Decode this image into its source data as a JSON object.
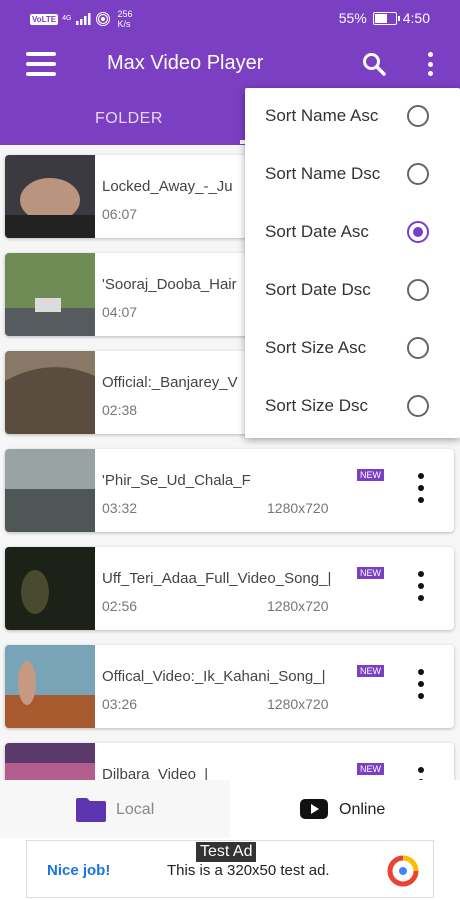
{
  "status_bar": {
    "network_tag": "VoLTE",
    "signal_type": "4G",
    "data_speed": "256\nK/s",
    "battery": "55%",
    "battery_level": 0.55,
    "time": "4:50"
  },
  "app_bar": {
    "title": "Max Video Player",
    "tab_folder": "FOLDER"
  },
  "sort_menu": {
    "options": [
      {
        "label": "Sort Name Asc",
        "selected": false
      },
      {
        "label": "Sort Name Dsc",
        "selected": false
      },
      {
        "label": "Sort Date Asc",
        "selected": true
      },
      {
        "label": "Sort Date Dsc",
        "selected": false
      },
      {
        "label": "Sort Size Asc",
        "selected": false
      },
      {
        "label": "Sort Size Dsc",
        "selected": false
      }
    ]
  },
  "videos": [
    {
      "title": "Locked_Away_-_Ju",
      "duration": "06:07",
      "resolution": "",
      "badge": ""
    },
    {
      "title": "'Sooraj_Dooba_Hair",
      "duration": "04:07",
      "resolution": "",
      "badge": ""
    },
    {
      "title": "Official:_Banjarey_V",
      "duration": "02:38",
      "resolution": "",
      "badge": ""
    },
    {
      "title": "'Phir_Se_Ud_Chala_F",
      "duration": "03:32",
      "resolution": "1280x720",
      "badge": "NEW"
    },
    {
      "title": "Uff_Teri_Adaa_Full_Video_Song_|",
      "duration": "02:56",
      "resolution": "1280x720",
      "badge": "NEW"
    },
    {
      "title": "Offical_Video:_Ik_Kahani_Song_|",
      "duration": "03:26",
      "resolution": "1280x720",
      "badge": "NEW"
    },
    {
      "title": "Dilbara_Video_|",
      "duration": "",
      "resolution": "",
      "badge": "NEW"
    }
  ],
  "bottom_nav": {
    "local": "Local",
    "online": "Online"
  },
  "ad": {
    "label": "Test Ad",
    "headline": "Nice job!",
    "text": "This is a 320x50 test ad."
  },
  "colors": {
    "primary": "#7b3fc4"
  }
}
